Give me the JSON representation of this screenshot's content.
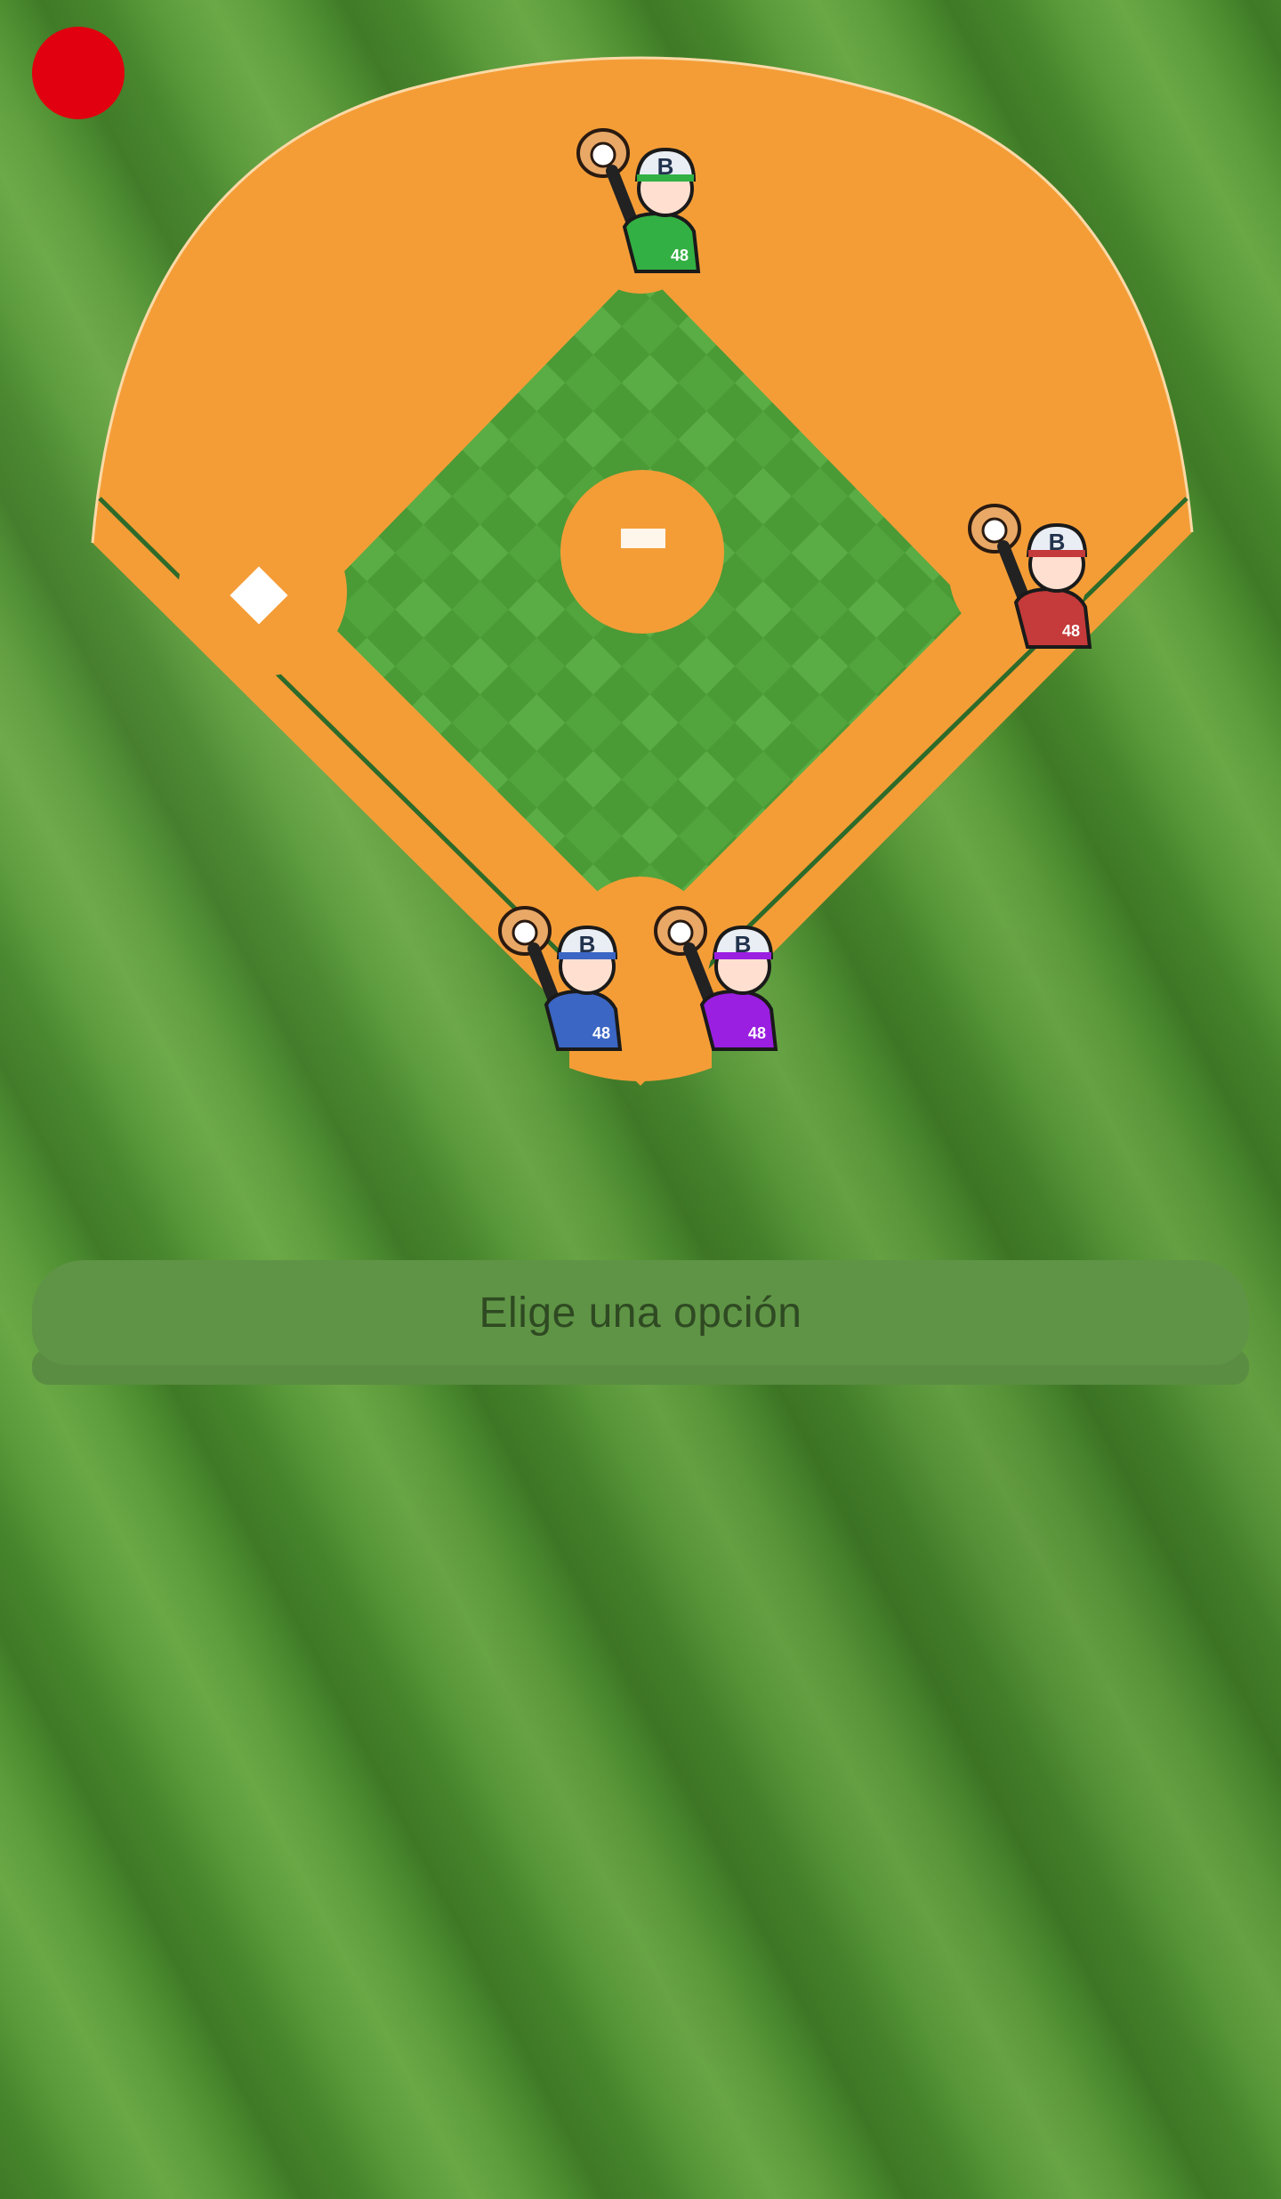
{
  "colors": {
    "dirt": "#f49d37",
    "infield_grass": "#4da33a",
    "record_button": "#e0000f",
    "option_bar": "#5f9446",
    "option_text": "#2f4a22"
  },
  "record_button": {
    "icon": "record-icon"
  },
  "players": [
    {
      "id": "top",
      "cap_letter": "B",
      "number": "48",
      "color": "#33b043"
    },
    {
      "id": "right",
      "cap_letter": "B",
      "number": "48",
      "color": "#c53a3a"
    },
    {
      "id": "bottom-left",
      "cap_letter": "B",
      "number": "48",
      "color": "#3b66c4"
    },
    {
      "id": "bottom-right",
      "cap_letter": "B",
      "number": "48",
      "color": "#9a1fe0"
    }
  ],
  "option_bar": {
    "label": "Elige una opción"
  }
}
